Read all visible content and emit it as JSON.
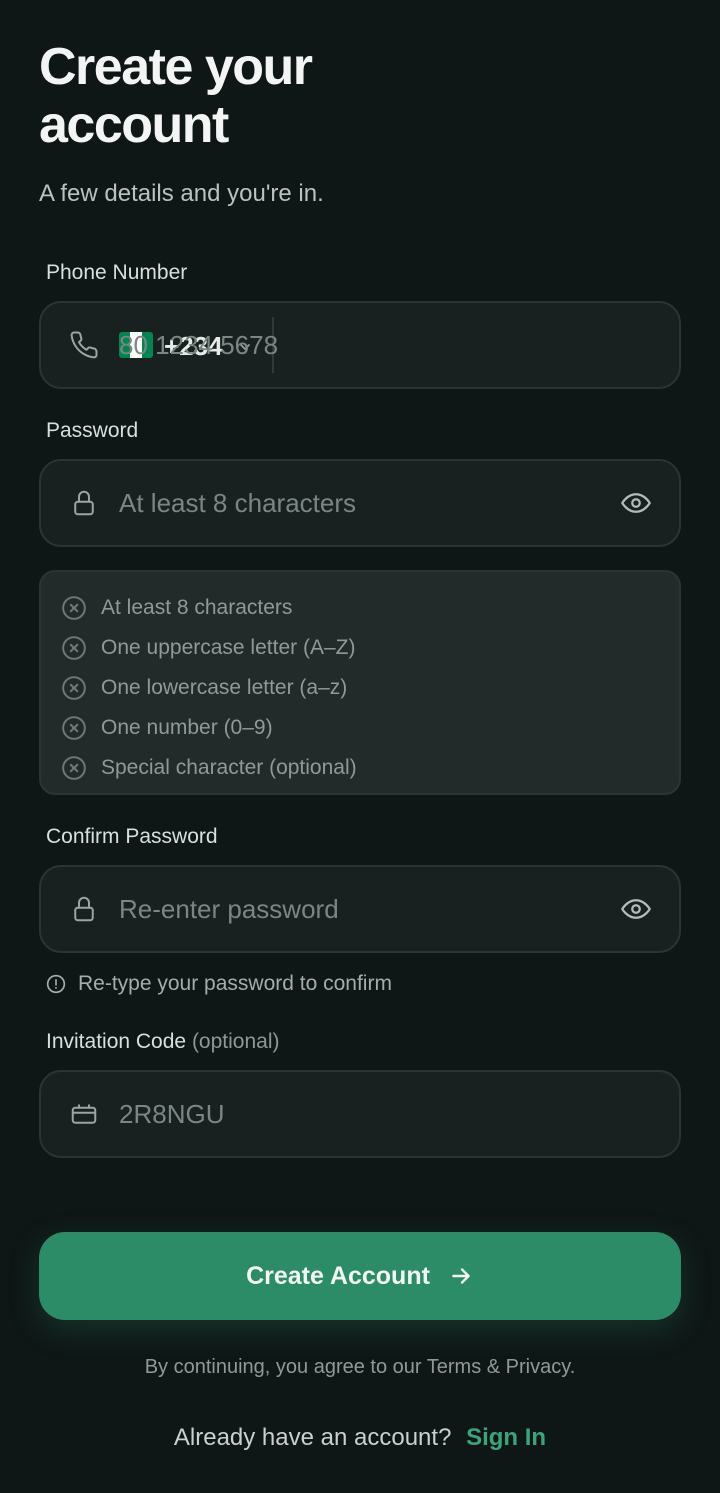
{
  "header": {
    "title": "Create your account",
    "subtitle": "A few details and you're in."
  },
  "phone": {
    "label": "Phone Number",
    "country_code": "+234",
    "flag_colors": [
      "#008751",
      "#ffffff",
      "#008751"
    ],
    "placeholder": "80 1234 5678",
    "icon": "phone-icon"
  },
  "password": {
    "label": "Password",
    "placeholder": "At least 8 characters",
    "rules": [
      "At least 8 characters",
      "One uppercase letter (A–Z)",
      "One lowercase letter (a–z)",
      "One number (0–9)",
      "Special character (optional)"
    ]
  },
  "confirm": {
    "label": "Confirm Password",
    "placeholder": "Re-enter password",
    "hint": "Re-type your password to confirm"
  },
  "invite": {
    "label": "Invitation Code",
    "label_optional": "(optional)",
    "placeholder": "2R8NGU"
  },
  "cta": {
    "label": "Create Account"
  },
  "footer": {
    "terms": "By continuing, you agree to our Terms & Privacy.",
    "signin_prompt": "Already have an account?",
    "signin_link": "Sign In"
  },
  "colors": {
    "background": "#0f1716",
    "accent": "#2c8c68",
    "link": "#3aa57c"
  }
}
